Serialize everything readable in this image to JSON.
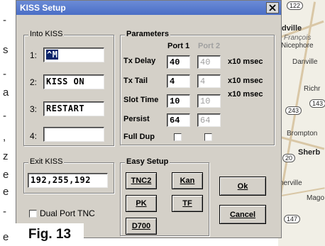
{
  "window": {
    "title": "KISS Setup"
  },
  "into_kiss": {
    "label": "Into KISS",
    "rows": [
      {
        "num": "1:",
        "value": "^M"
      },
      {
        "num": "2:",
        "value": "KISS ON"
      },
      {
        "num": "3:",
        "value": "RESTART"
      },
      {
        "num": "4:",
        "value": ""
      }
    ]
  },
  "parameters": {
    "label": "Parameters",
    "port1": "Port 1",
    "port2": "Port 2",
    "rows": [
      {
        "name": "Tx Delay",
        "p1": "40",
        "p2": "40",
        "unit": "x10 msec"
      },
      {
        "name": "Tx Tail",
        "p1": "4",
        "p2": "4",
        "unit": "x10 msec"
      },
      {
        "name": "Slot Time",
        "p1": "10",
        "p2": "10",
        "unit": "x10 msec"
      },
      {
        "name": "Persist",
        "p1": "64",
        "p2": "64",
        "unit": ""
      }
    ],
    "full_dup": "Full Dup"
  },
  "exit_kiss": {
    "label": "Exit KISS",
    "value": "192,255,192"
  },
  "easy_setup": {
    "label": "Easy Setup",
    "tnc2": "TNC2",
    "kan": "Kan",
    "pk": "PK",
    "tf": "TF",
    "d700": "D700"
  },
  "buttons": {
    "ok": "Ok",
    "cancel": "Cancel"
  },
  "dual_port": "Dual Port TNC",
  "figure_caption": "Fig. 13",
  "map_labels": {
    "ville": "dville",
    "francois": "François",
    "nicephore": "Nicephore",
    "danville": "Danville",
    "richmond": "Richr",
    "route243": "243",
    "route143": "143",
    "brompton": "Brompton",
    "sherbrooke": "Sherb",
    "route20": "20",
    "nerville": "nerville",
    "magog": "Mago",
    "route147": "147",
    "route122": "122"
  },
  "left_strip_glyphs": [
    "-",
    "s",
    "-",
    "a",
    "-",
    ",",
    "z",
    "e",
    "e",
    "-",
    "e"
  ]
}
